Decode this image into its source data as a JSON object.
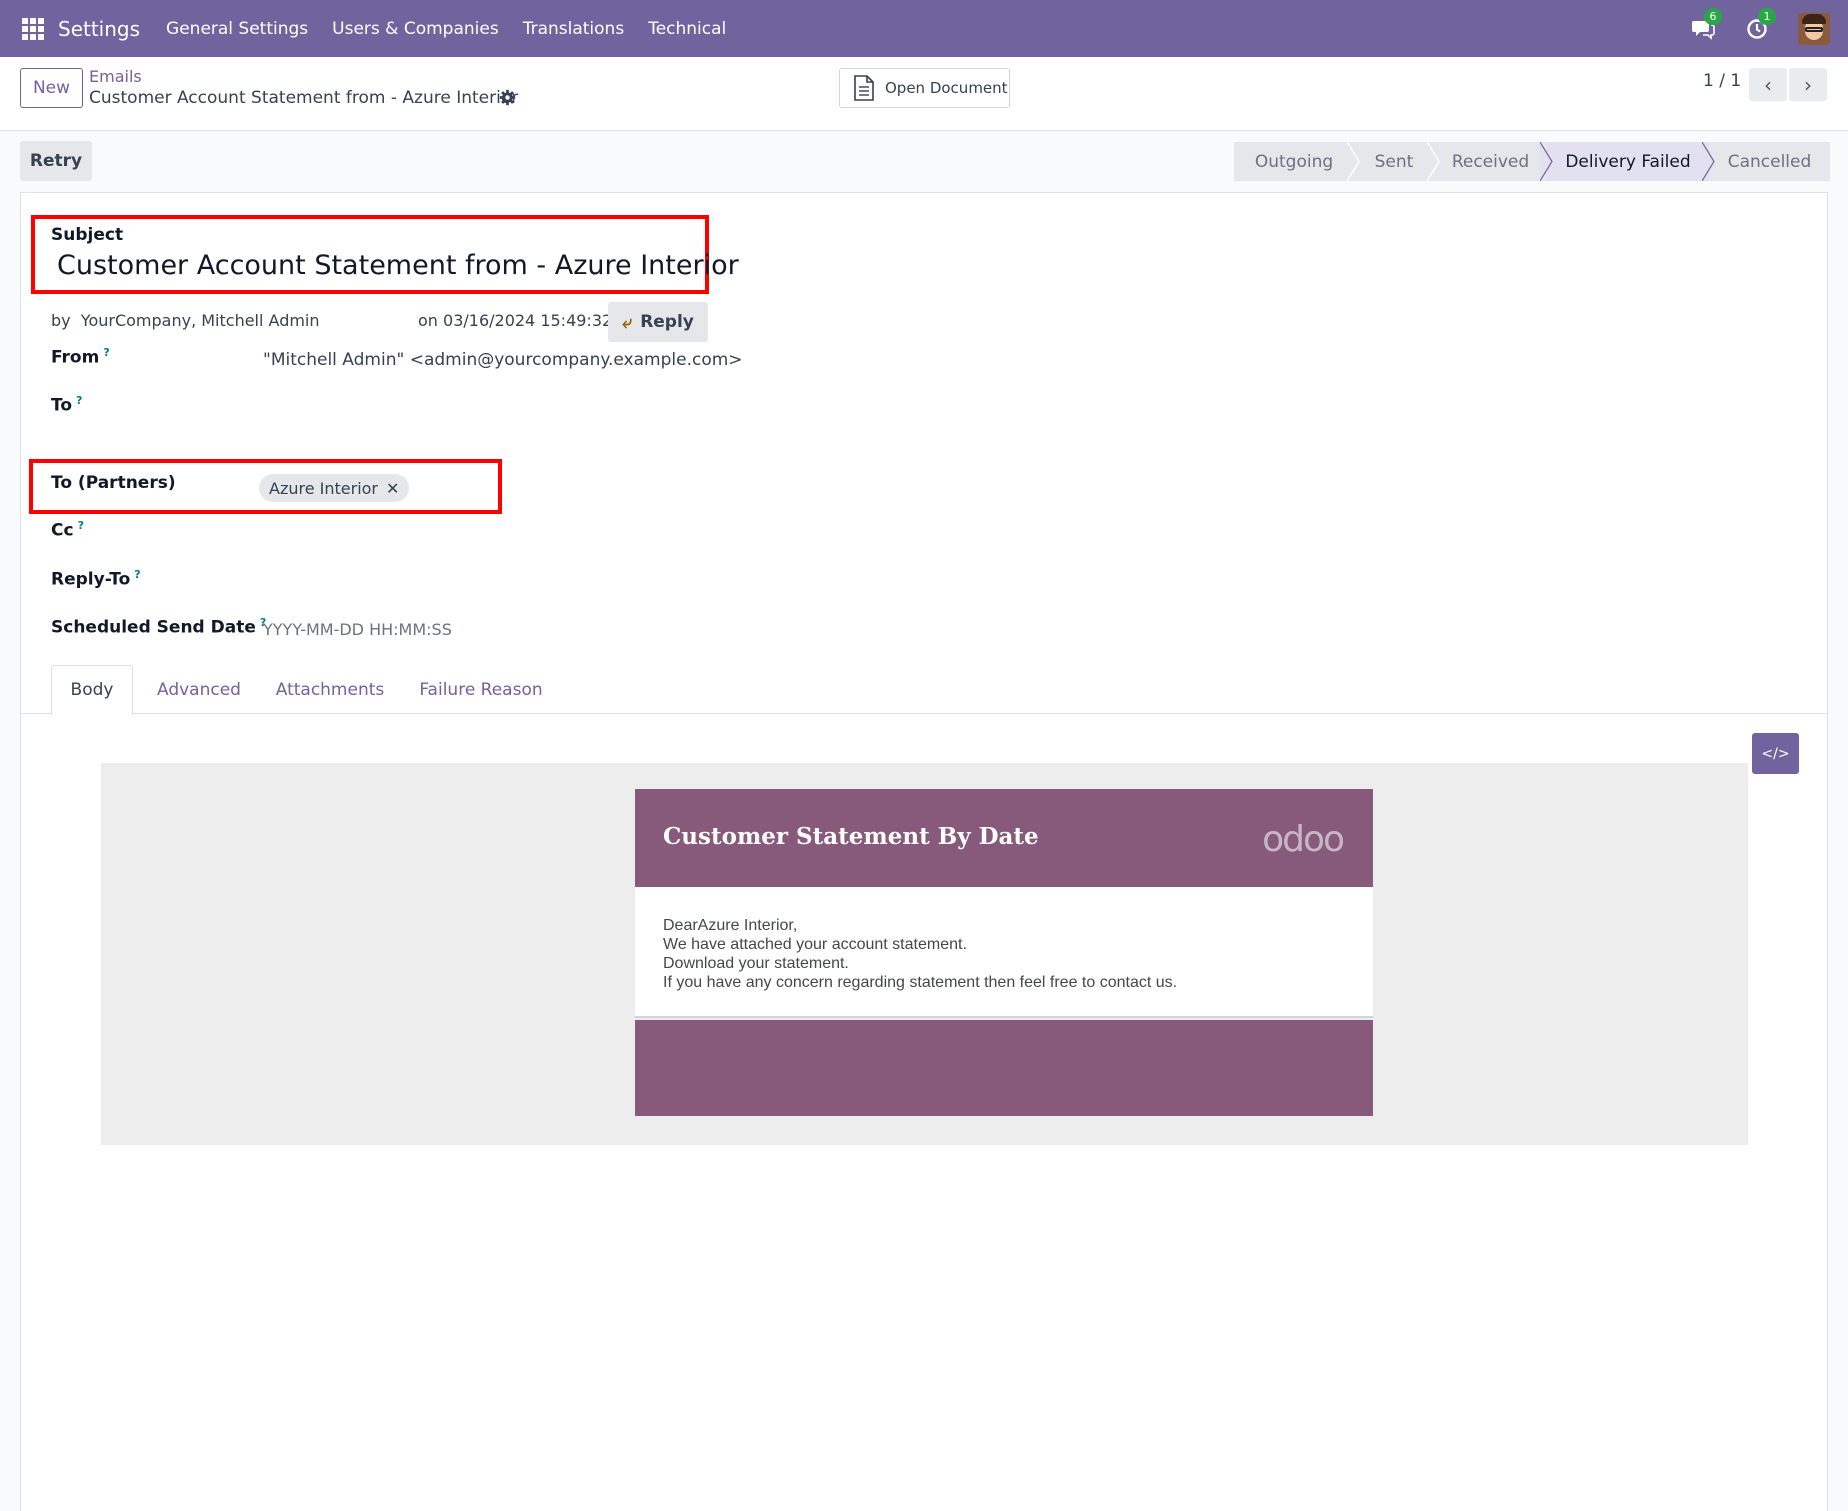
{
  "navbar": {
    "brand": "Settings",
    "menu": [
      "General Settings",
      "Users & Companies",
      "Translations",
      "Technical"
    ],
    "messages_count": "6",
    "activities_count": "1"
  },
  "control": {
    "new_label": "New",
    "breadcrumb_parent": "Emails",
    "breadcrumb_current": "Customer Account Statement from - Azure Interior",
    "open_document_label": "Open Document",
    "pager_value": "1 / 1"
  },
  "statusbar": {
    "retry_label": "Retry",
    "stages": [
      "Outgoing",
      "Sent",
      "Received",
      "Delivery Failed",
      "Cancelled"
    ],
    "active_stage": "Delivery Failed"
  },
  "form": {
    "subject_label": "Subject",
    "subject_value": "Customer Account Statement from  - Azure Interior",
    "by_prefix": "by",
    "author": "YourCompany, Mitchell Admin",
    "date_text": "on 03/16/2024 15:49:32",
    "reply_label": "Reply",
    "from_label": "From",
    "from_value": "\"Mitchell Admin\" <admin@yourcompany.example.com>",
    "to_label": "To",
    "to_partners_label": "To (Partners)",
    "partner_tag": "Azure Interior",
    "cc_label": "Cc",
    "reply_to_label": "Reply-To",
    "scheduled_label": "Scheduled Send Date",
    "scheduled_placeholder": "YYYY-MM-DD HH:MM:SS",
    "help_mark": "?"
  },
  "tabs": [
    "Body",
    "Advanced",
    "Attachments",
    "Failure Reason"
  ],
  "active_tab": "Body",
  "email_preview": {
    "title": "Customer Statement By Date",
    "logo_text": "odoo",
    "lines": [
      "DearAzure Interior,",
      "We have attached your account statement.",
      "Download your statement.",
      "If you have any concern regarding statement then feel free to contact us."
    ]
  },
  "colors": {
    "brand": "#71639e",
    "mail_header": "#875a7b",
    "highlight": "#ff0000",
    "badge": "#28a745"
  }
}
